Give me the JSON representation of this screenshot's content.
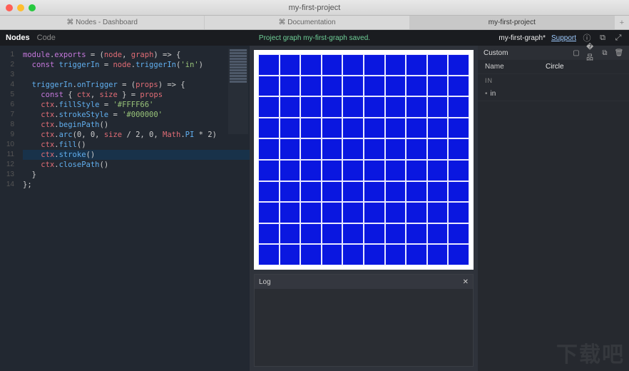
{
  "window": {
    "title": "my-first-project"
  },
  "outer_tabs": {
    "items": [
      {
        "label": "⌘ Nodes - Dashboard",
        "active": false
      },
      {
        "label": "⌘ Documentation",
        "active": false
      },
      {
        "label": "my-first-project",
        "active": true
      }
    ]
  },
  "topbar": {
    "modes": {
      "nodes": "Nodes",
      "code": "Code"
    },
    "status": "Project graph my-first-graph saved.",
    "graph_name": "my-first-graph*",
    "support": "Support",
    "icons": [
      "info-icon",
      "share-icon",
      "fullscreen-icon"
    ]
  },
  "code": {
    "lines": [
      "module.exports = (node, graph) => {",
      "  const triggerIn = node.triggerIn('in')",
      "",
      "  triggerIn.onTrigger = (props) => {",
      "    const { ctx, size } = props",
      "    ctx.fillStyle = '#FFFF66'",
      "    ctx.strokeStyle = '#000000'",
      "    ctx.beginPath()",
      "    ctx.arc(0, 0, size / 2, 0, Math.PI * 2)",
      "    ctx.fill()",
      "    ctx.stroke()",
      "    ctx.closePath()",
      "  }",
      "};"
    ],
    "highlight_line": 11
  },
  "canvas": {
    "grid_cols": 10,
    "grid_rows": 10,
    "fill": "#0a17e0"
  },
  "log": {
    "title": "Log"
  },
  "inspector": {
    "title": "Custom",
    "icons": [
      "square-icon",
      "nodes-icon",
      "copy-icon",
      "trash-icon"
    ],
    "name_label": "Name",
    "name_value": "Circle",
    "in_section": "IN",
    "in_item": "in"
  },
  "watermark": "下载吧"
}
